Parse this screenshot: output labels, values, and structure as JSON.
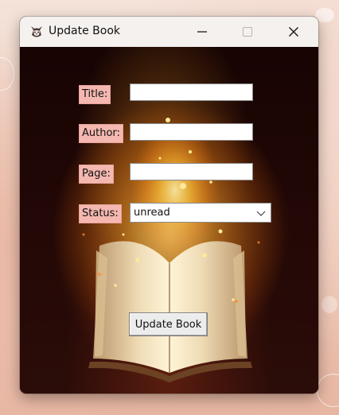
{
  "window": {
    "title": "Update Book",
    "app_icon": "cat-icon",
    "controls": [
      "minimize-icon",
      "maximize-icon",
      "close-icon"
    ]
  },
  "form": {
    "title_label": "Title:",
    "title_value": "",
    "author_label": "Author:",
    "author_value": "",
    "page_label": "Page:",
    "page_value": "",
    "status_label": "Status:",
    "status_value": "unread",
    "submit_label": "Update Book"
  },
  "colors": {
    "label_bg": "#f4b8b0",
    "titlebar_bg": "#f4f1ef"
  }
}
